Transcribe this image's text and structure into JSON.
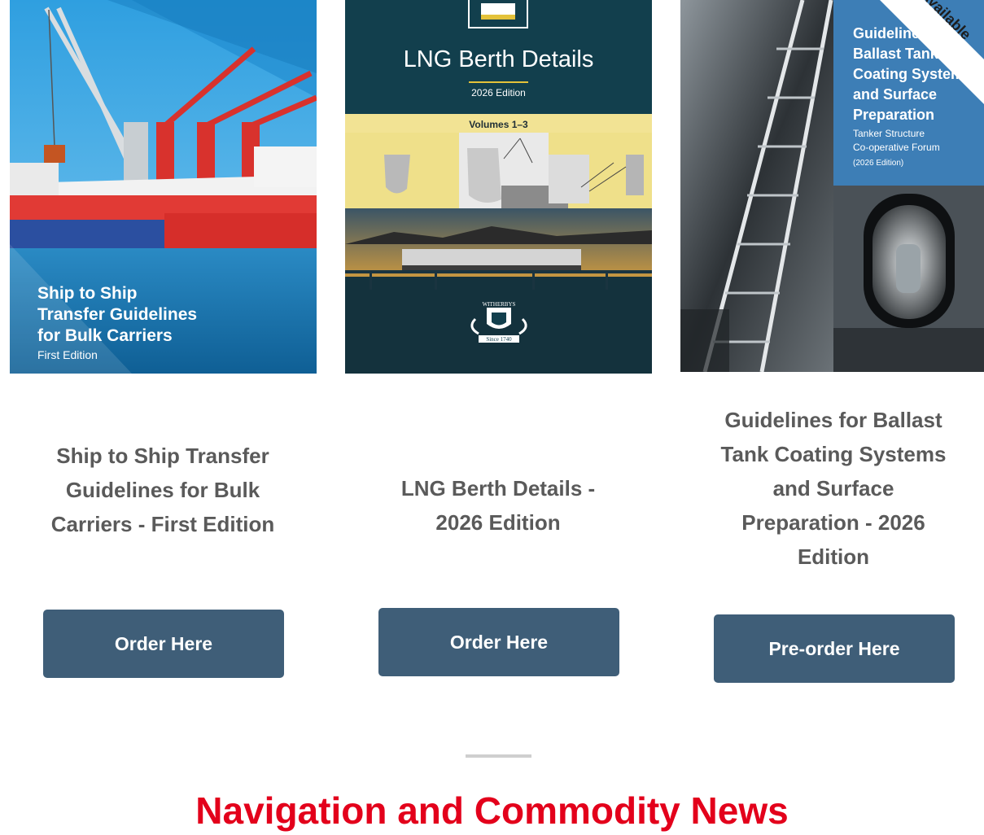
{
  "products": [
    {
      "cover": {
        "line1": "Ship to Ship",
        "line2": "Transfer Guidelines",
        "line3": "for Bulk Carriers",
        "edition": "First Edition"
      },
      "title": "Ship to Ship Transfer Guidelines for Bulk Carriers - First Edition",
      "button_label": "Order Here"
    },
    {
      "cover": {
        "title": "LNG Berth Details",
        "edition": "2026 Edition",
        "volumes": "Volumes 1–3",
        "publisher": "WITHERBYS",
        "since": "Since 1740"
      },
      "title": "LNG Berth Details - 2026 Edition",
      "button_label": "Order Here"
    },
    {
      "cover": {
        "banner": "Available",
        "line1": "Guidelines",
        "line2": "Ballast Tank",
        "line3": "Coating Systems",
        "line4": "and Surface",
        "line5": "Preparation",
        "org1": "Tanker Structure",
        "org2": "Co-operative Forum",
        "edition": "(2026 Edition)"
      },
      "title": "Guidelines for Ballast Tank Coating Systems and Surface Preparation - 2026 Edition",
      "button_label": "Pre-order Here"
    }
  ],
  "section_heading": "Navigation and Commodity News",
  "colors": {
    "button": "#3f5e78",
    "title_text": "#5a5a5a",
    "heading_red": "#e3001b",
    "lng_teal": "#123f4d",
    "lng_gold": "#f2e394"
  }
}
